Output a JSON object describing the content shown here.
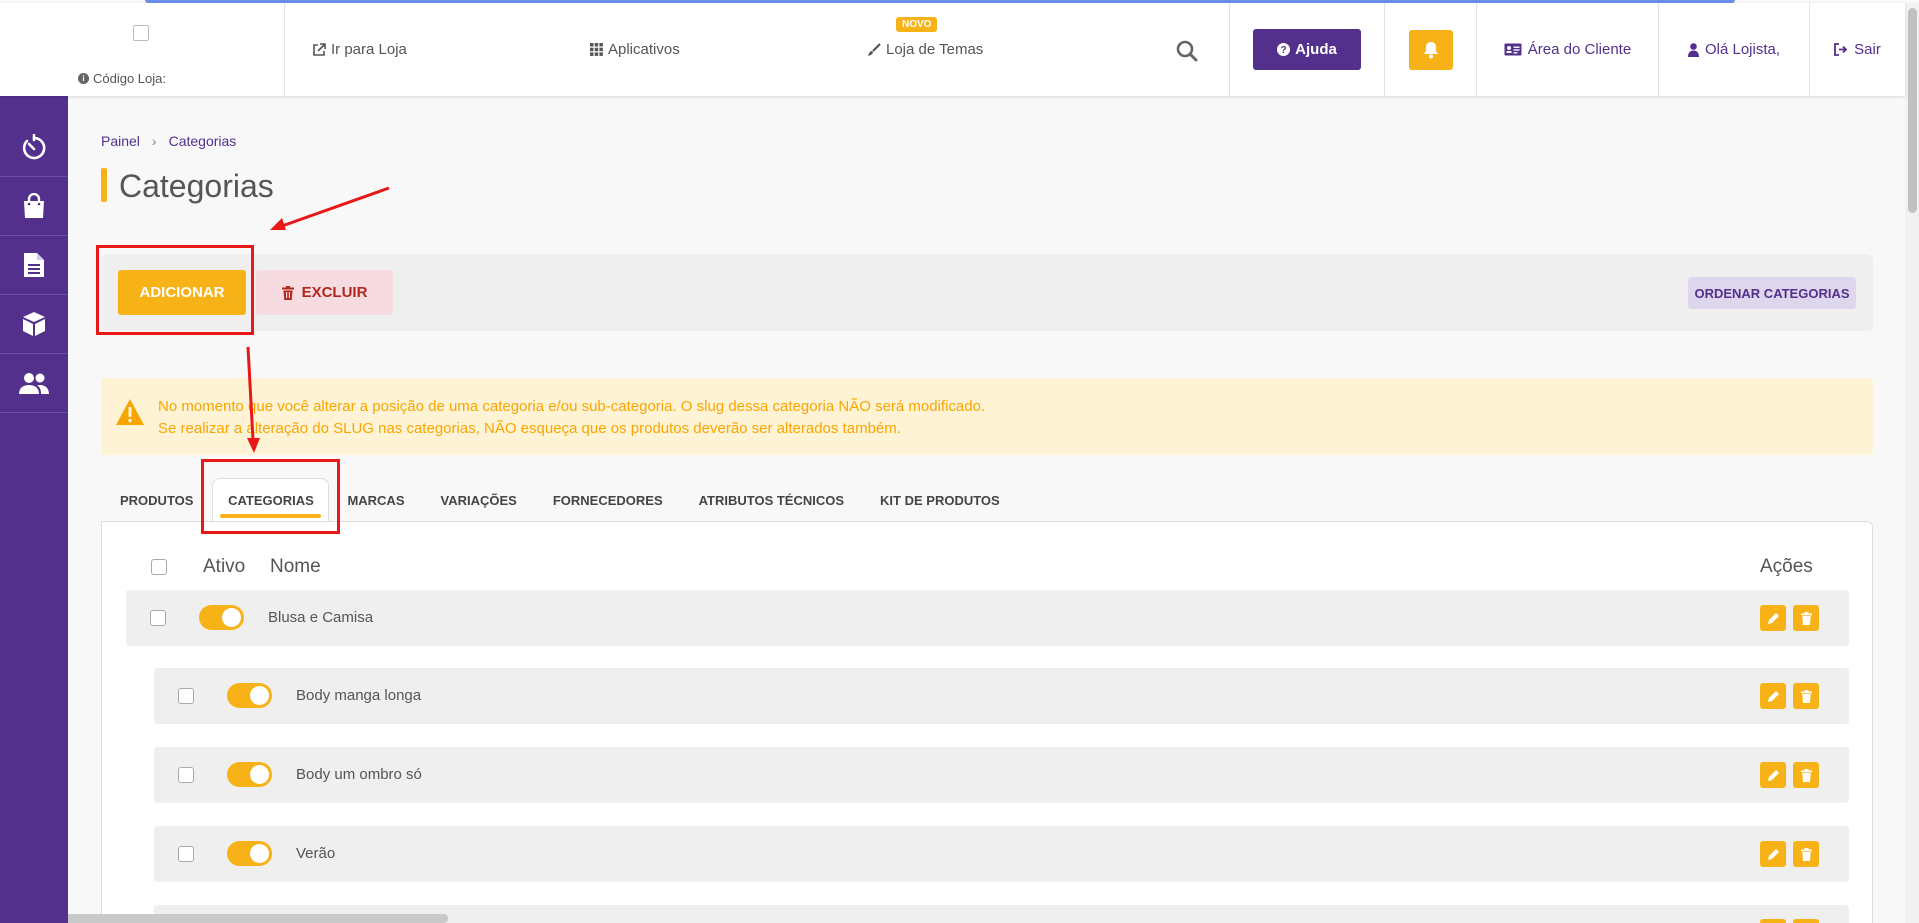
{
  "header": {
    "store_code_label": "Código Loja:",
    "nav": {
      "store_link": "Ir para Loja",
      "apps_link": "Aplicativos",
      "themes_link": "Loja de Temas",
      "new_badge": "NOVO"
    },
    "help_label": "Ajuda",
    "client_area": "Área do Cliente",
    "user_greeting": "Olá Lojista,",
    "logout": "Sair"
  },
  "sidebar": {
    "items": [
      {
        "icon": "dashboard-icon"
      },
      {
        "icon": "shopping-bag-icon"
      },
      {
        "icon": "document-icon"
      },
      {
        "icon": "box-icon"
      },
      {
        "icon": "users-icon"
      }
    ]
  },
  "breadcrumb": {
    "home": "Painel",
    "separator": "›",
    "current": "Categorias"
  },
  "page": {
    "title": "Categorias"
  },
  "actions": {
    "add_label": "ADICIONAR",
    "delete_label": "EXCLUIR",
    "order_label": "ORDENAR CATEGORIAS"
  },
  "alert": {
    "line1": "No momento que você alterar a posição de uma categoria e/ou sub-categoria. O slug dessa categoria NÃO será modificado.",
    "line2": "Se realizar a alteração do SLUG nas categorias, NÃO esqueça que os produtos deverão ser alterados também."
  },
  "tabs": [
    {
      "label": "PRODUTOS",
      "active": false
    },
    {
      "label": "CATEGORIAS",
      "active": true
    },
    {
      "label": "MARCAS",
      "active": false
    },
    {
      "label": "VARIAÇÕES",
      "active": false
    },
    {
      "label": "FORNECEDORES",
      "active": false
    },
    {
      "label": "ATRIBUTOS TÉCNICOS",
      "active": false
    },
    {
      "label": "KIT DE PRODUTOS",
      "active": false
    }
  ],
  "table": {
    "col_active": "Ativo",
    "col_name": "Nome",
    "col_actions": "Ações",
    "rows": [
      {
        "name": "Blusa e Camisa",
        "active": true,
        "level": 0
      },
      {
        "name": "Body manga longa",
        "active": true,
        "level": 1
      },
      {
        "name": "Body um ombro só",
        "active": true,
        "level": 1
      },
      {
        "name": "Verão",
        "active": true,
        "level": 1
      }
    ]
  },
  "colors": {
    "brand_purple": "#52308c",
    "accent_yellow": "#f7b217",
    "annotation_red": "#e81818"
  }
}
